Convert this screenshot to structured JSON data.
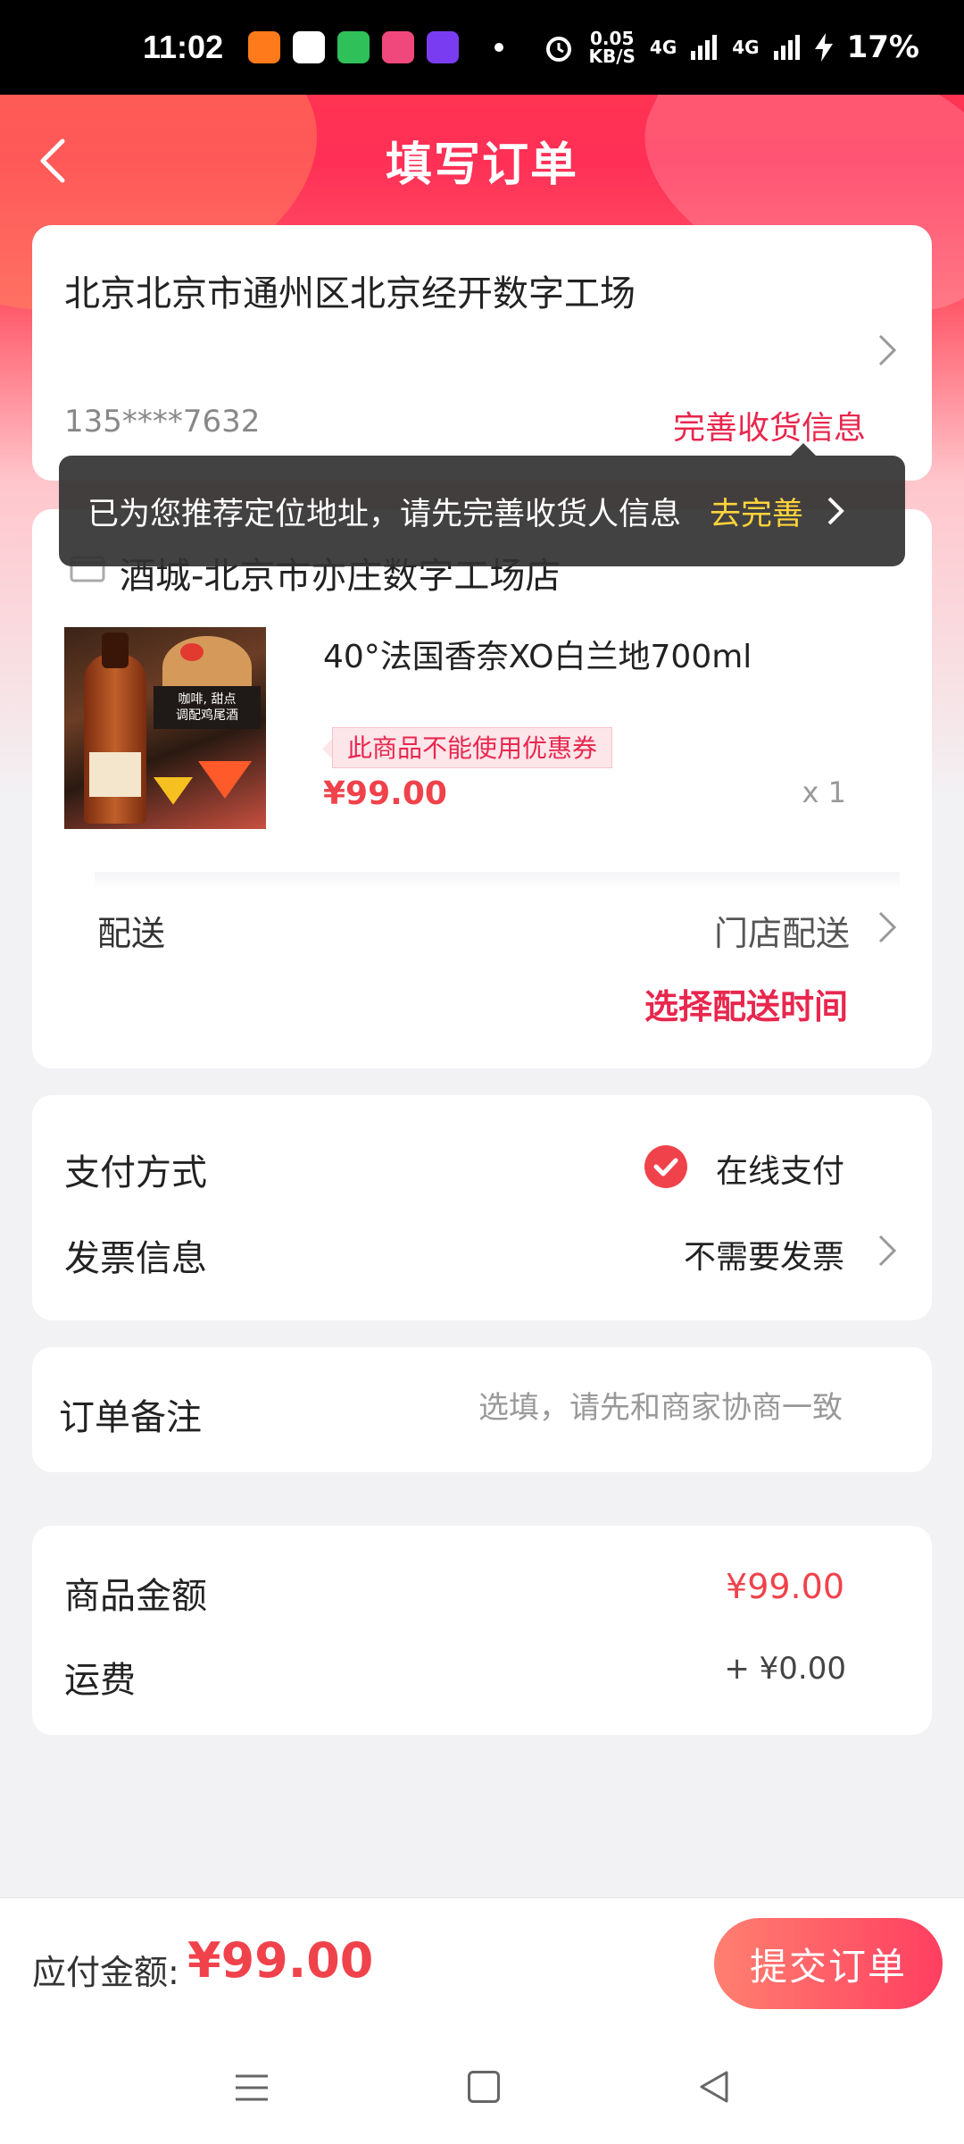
{
  "status_bar": {
    "time": "11:02",
    "speed_value": "0.05",
    "speed_unit": "KB/S",
    "signal1": "4G",
    "signal2": "4G",
    "battery": "17%"
  },
  "header": {
    "title": "填写订单"
  },
  "address": {
    "text": "北京北京市通州区北京经开数字工场",
    "phone": "135****7632",
    "complete_link": "完善收货信息"
  },
  "toast": {
    "message": "已为您推荐定位地址，请先完善收货人信息",
    "action": "去完善"
  },
  "store": {
    "name": "酒城-北京市亦庄数字工场店",
    "product": {
      "name": "40°法国香奈XO白兰地700ml",
      "image_caption_line1": "咖啡, 甜点",
      "image_caption_line2": "调配鸡尾酒",
      "coupon_note": "此商品不能使用优惠券",
      "price": "¥99.00",
      "quantity": "x 1"
    },
    "shipping_label": "配送",
    "shipping_value": "门店配送",
    "shipping_time": "选择配送时间"
  },
  "payment": {
    "method_label": "支付方式",
    "method_value": "在线支付",
    "invoice_label": "发票信息",
    "invoice_value": "不需要发票"
  },
  "note": {
    "label": "订单备注",
    "placeholder": "选填，请先和商家协商一致"
  },
  "summary": {
    "goods_label": "商品金额",
    "goods_amount": "¥99.00",
    "freight_label": "运费",
    "freight_amount": "+ ¥0.00"
  },
  "bottom": {
    "pay_label": "应付金额:",
    "pay_amount": "¥99.00",
    "submit_label": "提交订单"
  },
  "colors": {
    "accent": "#f0424b",
    "brand_red": "#e8274e",
    "header_gradient_top": "#ff3a4c"
  }
}
